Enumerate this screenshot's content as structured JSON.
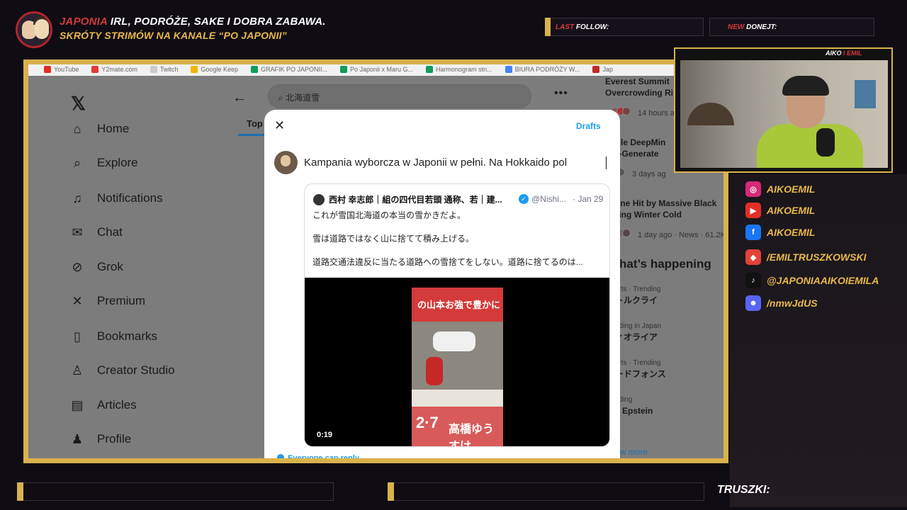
{
  "overlay": {
    "header_line1_red": "JAPONIA",
    "header_line1_rest": " IRL, PODRÓŻE, SAKE I DOBRA ZABAWA.",
    "header_line2": "SKRÓTY STRIMÓW NA KANALE “PO JAPONII”",
    "last_follow_prefix": "LAST",
    "last_follow_label": " FOLLOW:",
    "new_donate_prefix": "NEW",
    "new_donate_label": " DONEJT:",
    "cam_label_a": "AIKO",
    "cam_label_sep": " I ",
    "cam_label_b": "EMIL",
    "socials": [
      {
        "icon": "instagram-icon",
        "text": "AIKOEMIL",
        "color": "#d62976"
      },
      {
        "icon": "youtube-icon",
        "text": "AIKOEMIL",
        "color": "#e52d27"
      },
      {
        "icon": "facebook-icon",
        "text": "AIKOEMIL",
        "color": "#1877f2"
      },
      {
        "icon": "patronite-icon",
        "text": "/EMILTRUSZKOWSKI",
        "color": "#e2433b"
      },
      {
        "icon": "tiktok-icon",
        "text": "@JAPONIAAIKOIEMILA",
        "color": "#111111"
      },
      {
        "icon": "discord-icon",
        "text": "/nmwJdUS",
        "color": "#5865f2"
      }
    ],
    "truszki": "TRUSZKI:"
  },
  "browser": {
    "bookmarks": [
      {
        "label": "YouTube",
        "color": "#e52d27"
      },
      {
        "label": "Y2mate.com",
        "color": "#e53935"
      },
      {
        "label": "Twitch",
        "color": "#cccccc"
      },
      {
        "label": "Google Keep",
        "color": "#f4b400"
      },
      {
        "label": "GRAFIK PO JAPONII...",
        "color": "#0f9d58"
      },
      {
        "label": "Po Japonii x Maru G...",
        "color": "#0f9d58"
      },
      {
        "label": "Harmonogram stn...",
        "color": "#0f9d58"
      },
      {
        "label": "BIURA PODRÓŻY W...",
        "color": "#4285f4"
      },
      {
        "label": "Jap",
        "color": "#c62828"
      }
    ]
  },
  "x": {
    "nav": [
      {
        "name": "home",
        "icon": "⌂",
        "label": "Home"
      },
      {
        "name": "explore",
        "icon": "⌕",
        "label": "Explore"
      },
      {
        "name": "notifications",
        "icon": "♫",
        "label": "Notifications"
      },
      {
        "name": "chat",
        "icon": "✉",
        "label": "Chat"
      },
      {
        "name": "grok",
        "icon": "⊘",
        "label": "Grok"
      },
      {
        "name": "premium",
        "icon": "✕",
        "label": "Premium"
      },
      {
        "name": "bookmarks",
        "icon": "▯",
        "label": "Bookmarks"
      },
      {
        "name": "creator-studio",
        "icon": "♙",
        "label": "Creator Studio"
      },
      {
        "name": "articles",
        "icon": "▤",
        "label": "Articles"
      },
      {
        "name": "profile",
        "icon": "♟",
        "label": "Profile"
      }
    ],
    "search_value": "北海道雪",
    "top_tab": "Top",
    "right": {
      "news1_title_a": "Everest Summit",
      "news1_title_b": "Overcrowding Ri",
      "news1_meta": "14 hours a",
      "news2_title_a": "oogle DeepMin",
      "news2_title_b": "r AI-Generate",
      "news2_meta": "3 days ag",
      "news3_title_a": "kraine Hit by Massive Black",
      "news3_title_b": "eezing Winter Cold",
      "news3_meta": "1 day ago · News · 61.2K",
      "happening": "What’s happening",
      "trends": [
        {
          "meta": "orts · Trending",
          "name": "トルクライ"
        },
        {
          "meta": "nding in Japan",
          "name": "ィオライア"
        },
        {
          "meta": "orts · Trending",
          "name": "ードフォンス"
        },
        {
          "meta": "nding",
          "name": "e Epstein"
        }
      ],
      "show_more": "ow more"
    },
    "modal": {
      "drafts": "Drafts",
      "compose_text": "Kampania wyborcza w Japonii w pełni. Na Hokkaido pol",
      "quote_name": "西村 幸志郎｜組の四代目若頭 通称、若｜建...",
      "quote_handle": "@Nishi...",
      "quote_date": "· Jan 29",
      "quote_lines": [
        "これが雪国北海道の本当の雪かきだよ。",
        "雪は道路ではなく山に捨てて積み上げる。",
        "道路交通法違反に当たる道路への雪捨てをしない。道路に捨てるのは..."
      ],
      "video_banner": "の山本お強で豊かに",
      "video_date": "2·7",
      "video_name": "高橋ゆうすけ",
      "video_time": "0:19",
      "reply_setting": "Everyone can reply"
    }
  }
}
